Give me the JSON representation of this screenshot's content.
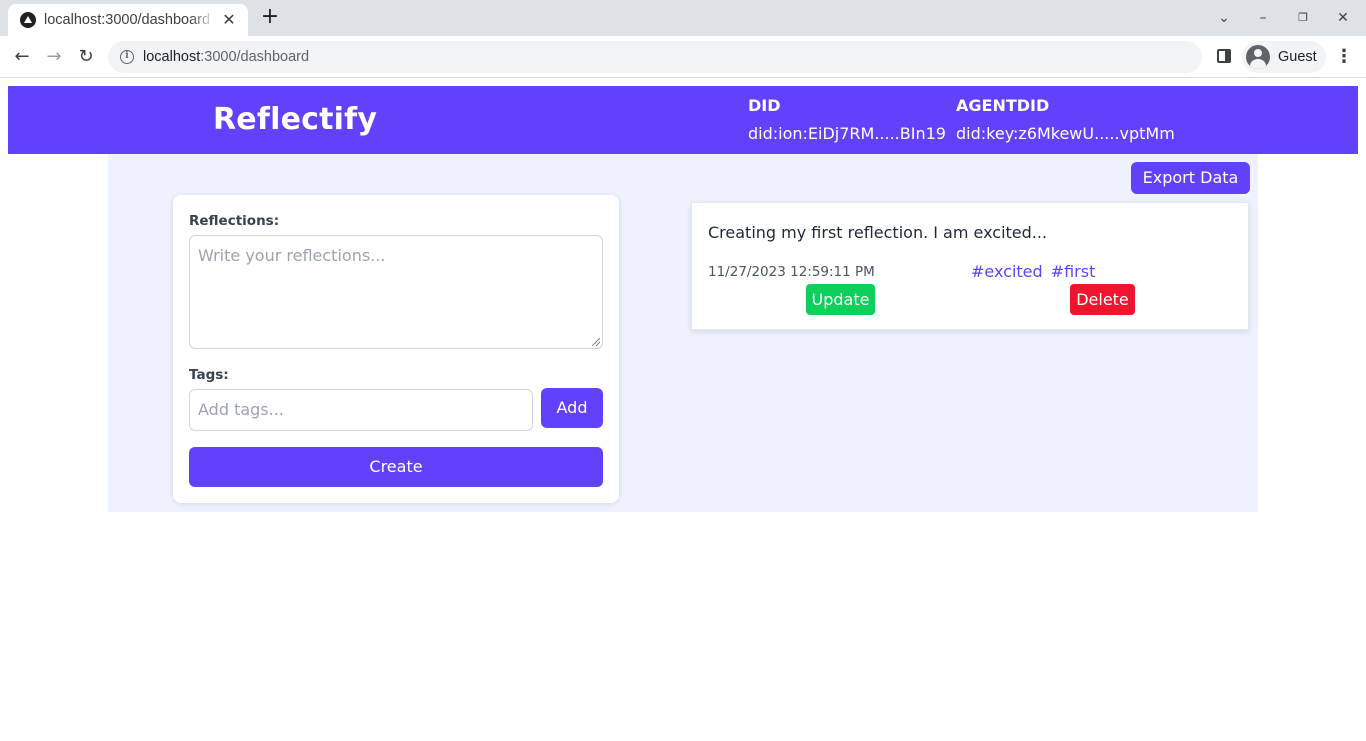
{
  "browser": {
    "tab_title": "localhost:3000/dashboard",
    "tab_close_icon": "close-icon",
    "new_tab_icon": "plus-icon",
    "url_host": "localhost",
    "url_rest": ":3000/dashboard",
    "profile_name": "Guest",
    "window_controls": [
      "chevron-down-icon",
      "minimize-icon",
      "restore-icon",
      "close-icon"
    ]
  },
  "header": {
    "brand": "Reflectify",
    "did_label": "DID",
    "did_value": "did:ion:EiDj7RM.....BIn19",
    "agentdid_label": "AGENTDID",
    "agentdid_value": "did:key:z6MkewU.....vptMm",
    "color": "#6241fb"
  },
  "toolbar": {
    "export_label": "Export Data"
  },
  "form": {
    "reflections_label": "Reflections:",
    "reflections_placeholder": "Write your reflections...",
    "tags_label": "Tags:",
    "tags_placeholder": "Add tags...",
    "add_label": "Add",
    "create_label": "Create"
  },
  "reflections": [
    {
      "text": "Creating my first reflection. I am excited...",
      "timestamp": "11/27/2023 12:59:11 PM",
      "tags": [
        "#excited",
        "#first"
      ],
      "update_label": "Update",
      "delete_label": "Delete"
    }
  ],
  "colors": {
    "accent": "#6241fb",
    "update": "#0ccf5c",
    "delete": "#f0142e",
    "background": "#eef2ff"
  }
}
